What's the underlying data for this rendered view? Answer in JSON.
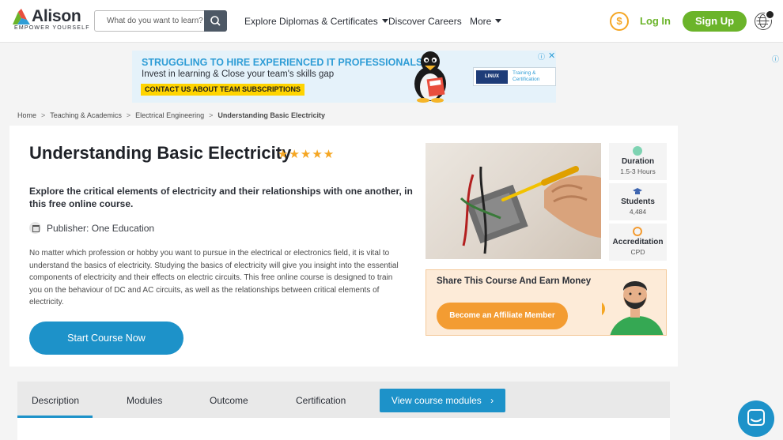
{
  "header": {
    "logo_name": "Alison",
    "logo_tagline": "EMPOWER YOURSELF",
    "search_placeholder": "What do you want to learn?",
    "nav": [
      "Explore Diplomas & Certificates",
      "Discover Careers",
      "More"
    ],
    "coin_symbol": "$",
    "login_label": "Log In",
    "signup_label": "Sign Up"
  },
  "ad": {
    "headline": "STRUGGLING TO HIRE EXPERIENCED IT PROFESSIONALS?",
    "subline": "Invest in learning & Close your team's skills gap",
    "cta": "CONTACT US ABOUT TEAM SUBSCRIPTIONS",
    "partner_logo": "LINUX",
    "partner_text_1": "Training &",
    "partner_text_2": "Certification",
    "info_glyph": "ⓘ",
    "close_glyph": "✕"
  },
  "breadcrumb": [
    "Home",
    "Teaching & Academics",
    "Electrical Engineering",
    "Understanding Basic Electricity"
  ],
  "course": {
    "title": "Understanding Basic Electricity",
    "stars": "★★★★★",
    "lead": "Explore the critical elements of electricity and their relationships with one another, in this free online course.",
    "publisher": "Publisher: One Education",
    "description": "No matter which profession or hobby you want to pursue in the electrical or electronics field, it is vital to understand the basics of electricity. Studying the basics of electricity will give you insight into the essential components of electricity and their effects on electric circuits. This free online course is designed to train you on the behaviour of DC and AC circuits, as well as the relationships between critical elements of electricity.",
    "start_label": "Start Course Now"
  },
  "stats": [
    {
      "label": "Duration",
      "value": "1.5-3 Hours",
      "color": "#7ed3b2"
    },
    {
      "label": "Students",
      "value": "4,484",
      "color": "#3f66b0"
    },
    {
      "label": "Accreditation",
      "value": "CPD",
      "color": "#f39c32"
    }
  ],
  "affiliate": {
    "title": "Share This Course And Earn Money",
    "button": "Become an Affiliate Member",
    "coin_symbol": "$"
  },
  "tabs": {
    "items": [
      "Description",
      "Modules",
      "Outcome",
      "Certification"
    ],
    "active": "Description",
    "modules_button": "View course modules"
  },
  "colors": {
    "primary_blue": "#1d92c9",
    "green": "#6bb42a",
    "orange": "#f39c32"
  }
}
